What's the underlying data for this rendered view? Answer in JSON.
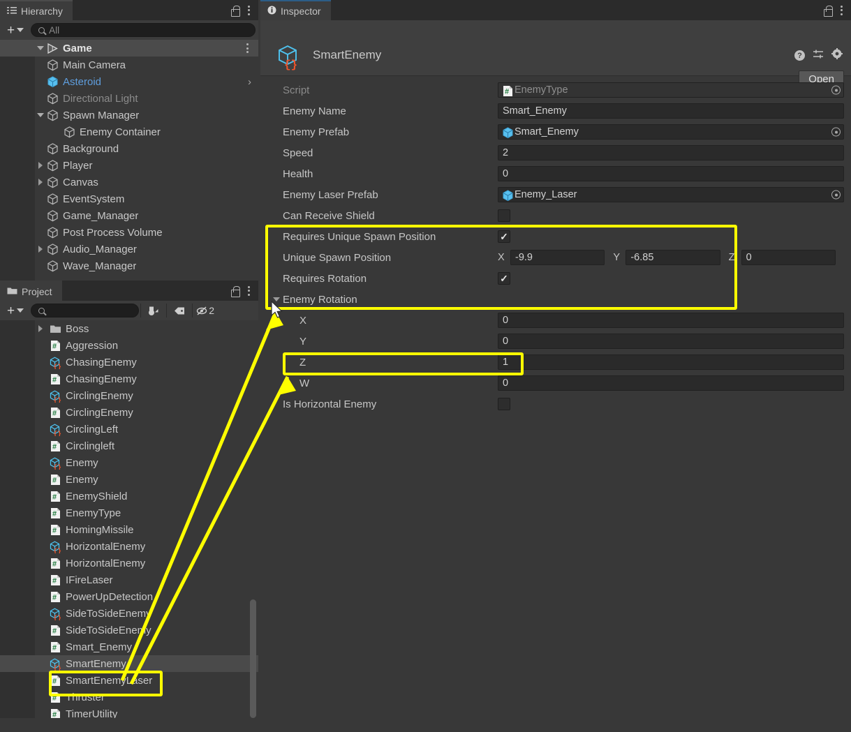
{
  "hierarchy_panel": {
    "tab_label": "Hierarchy",
    "tab_icon": "hierarchy-icon",
    "lock_icon": "lock-icon",
    "menu_icon": "kebab-menu-icon",
    "add_button_label": "+",
    "search_placeholder": "All",
    "search_value": "",
    "scene_name": "Game",
    "items": [
      {
        "label": "Main Camera",
        "icon": "gameobject-cube-icon",
        "indent": 2,
        "twisty": "none",
        "state": "normal"
      },
      {
        "label": "Asteroid",
        "icon": "prefab-cube-icon",
        "indent": 2,
        "twisty": "none",
        "state": "prefab-link",
        "chevron": true
      },
      {
        "label": "Directional Light",
        "icon": "gameobject-cube-icon",
        "indent": 2,
        "twisty": "none",
        "state": "disabled"
      },
      {
        "label": "Spawn Manager",
        "icon": "gameobject-cube-icon",
        "indent": 2,
        "twisty": "expanded",
        "state": "normal"
      },
      {
        "label": "Enemy Container",
        "icon": "gameobject-cube-icon",
        "indent": 3,
        "twisty": "none",
        "state": "normal"
      },
      {
        "label": "Background",
        "icon": "gameobject-cube-icon",
        "indent": 2,
        "twisty": "none",
        "state": "normal"
      },
      {
        "label": "Player",
        "icon": "gameobject-cube-icon",
        "indent": 2,
        "twisty": "collapsed",
        "state": "normal"
      },
      {
        "label": "Canvas",
        "icon": "gameobject-cube-icon",
        "indent": 2,
        "twisty": "collapsed",
        "state": "normal"
      },
      {
        "label": "EventSystem",
        "icon": "gameobject-cube-icon",
        "indent": 2,
        "twisty": "none",
        "state": "normal"
      },
      {
        "label": "Game_Manager",
        "icon": "gameobject-cube-icon",
        "indent": 2,
        "twisty": "none",
        "state": "normal"
      },
      {
        "label": "Post Process Volume",
        "icon": "gameobject-cube-icon",
        "indent": 2,
        "twisty": "none",
        "state": "normal"
      },
      {
        "label": "Audio_Manager",
        "icon": "gameobject-cube-icon",
        "indent": 2,
        "twisty": "collapsed",
        "state": "normal"
      },
      {
        "label": "Wave_Manager",
        "icon": "gameobject-cube-icon",
        "indent": 2,
        "twisty": "none",
        "state": "normal"
      }
    ]
  },
  "project_panel": {
    "tab_label": "Project",
    "tab_icon": "folder-icon",
    "lock_icon": "lock-icon",
    "menu_icon": "kebab-menu-icon",
    "add_button_label": "+",
    "search_placeholder": "",
    "search_value": "",
    "filter_buttons": [
      {
        "name": "type-filter-icon",
        "label": ""
      },
      {
        "name": "label-filter-icon",
        "label": ""
      },
      {
        "name": "hidden-packages-filter-icon",
        "label": "2"
      }
    ],
    "items": [
      {
        "label": "Boss",
        "icon": "folder-icon",
        "twisty": "collapsed",
        "selected": false
      },
      {
        "label": "Aggression",
        "icon": "cs-script-icon",
        "twisty": "none",
        "selected": false
      },
      {
        "label": "ChasingEnemy",
        "icon": "scriptable-object-icon",
        "twisty": "none",
        "selected": false
      },
      {
        "label": "ChasingEnemy",
        "icon": "cs-script-icon",
        "twisty": "none",
        "selected": false
      },
      {
        "label": "CirclingEnemy",
        "icon": "scriptable-object-icon",
        "twisty": "none",
        "selected": false
      },
      {
        "label": "CirclingEnemy",
        "icon": "cs-script-icon",
        "twisty": "none",
        "selected": false
      },
      {
        "label": "CirclingLeft",
        "icon": "scriptable-object-icon",
        "twisty": "none",
        "selected": false
      },
      {
        "label": "Circlingleft",
        "icon": "cs-script-icon",
        "twisty": "none",
        "selected": false
      },
      {
        "label": "Enemy",
        "icon": "scriptable-object-icon",
        "twisty": "none",
        "selected": false
      },
      {
        "label": "Enemy",
        "icon": "cs-script-icon",
        "twisty": "none",
        "selected": false
      },
      {
        "label": "EnemyShield",
        "icon": "cs-script-icon",
        "twisty": "none",
        "selected": false
      },
      {
        "label": "EnemyType",
        "icon": "cs-script-icon",
        "twisty": "none",
        "selected": false
      },
      {
        "label": "HomingMissile",
        "icon": "cs-script-icon",
        "twisty": "none",
        "selected": false
      },
      {
        "label": "HorizontalEnemy",
        "icon": "scriptable-object-icon",
        "twisty": "none",
        "selected": false
      },
      {
        "label": "HorizontalEnemy",
        "icon": "cs-script-icon",
        "twisty": "none",
        "selected": false
      },
      {
        "label": "IFireLaser",
        "icon": "cs-script-icon",
        "twisty": "none",
        "selected": false
      },
      {
        "label": "PowerUpDetection",
        "icon": "cs-script-icon",
        "twisty": "none",
        "selected": false
      },
      {
        "label": "SideToSideEnemy",
        "icon": "scriptable-object-icon",
        "twisty": "none",
        "selected": false
      },
      {
        "label": "SideToSideEnemy",
        "icon": "cs-script-icon",
        "twisty": "none",
        "selected": false
      },
      {
        "label": "Smart_Enemy",
        "icon": "cs-script-icon",
        "twisty": "none",
        "selected": false
      },
      {
        "label": "SmartEnemy",
        "icon": "scriptable-object-icon",
        "twisty": "none",
        "selected": true
      },
      {
        "label": "SmartEnemyLaser",
        "icon": "cs-script-icon",
        "twisty": "none",
        "selected": false
      },
      {
        "label": "Thruster",
        "icon": "cs-script-icon",
        "twisty": "none",
        "selected": false
      },
      {
        "label": "TimerUtility",
        "icon": "cs-script-icon",
        "twisty": "none",
        "selected": false
      }
    ]
  },
  "inspector": {
    "tab_label": "Inspector",
    "tab_icon": "info-icon",
    "lock_icon": "lock-icon",
    "menu_icon": "kebab-menu-icon",
    "object_name": "SmartEnemy",
    "object_icon": "scriptable-object-icon",
    "help_icon": "help-icon",
    "preset_icon": "preset-icon",
    "settings_icon": "gear-icon",
    "open_button_label": "Open",
    "properties": [
      {
        "label": "Script",
        "type": "object",
        "value": "EnemyType",
        "value_icon": "cs-script-icon",
        "readonly": true
      },
      {
        "label": "Enemy Name",
        "type": "text",
        "value": "Smart_Enemy"
      },
      {
        "label": "Enemy Prefab",
        "type": "object",
        "value": "Smart_Enemy",
        "value_icon": "prefab-cube-icon"
      },
      {
        "label": "Speed",
        "type": "number",
        "value": "2"
      },
      {
        "label": "Health",
        "type": "number",
        "value": "0"
      },
      {
        "label": "Enemy Laser Prefab",
        "type": "object",
        "value": "Enemy_Laser",
        "value_icon": "prefab-cube-icon"
      },
      {
        "label": "Can Receive Shield",
        "type": "bool",
        "checked": false
      },
      {
        "label": "Requires Unique Spawn Position",
        "type": "bool",
        "checked": true
      },
      {
        "label": "Unique Spawn Position",
        "type": "vector3",
        "x_label": "X",
        "x": "-9.9",
        "y_label": "Y",
        "y": "-6.85",
        "z_label": "Z",
        "z": "0"
      },
      {
        "label": "Requires Rotation",
        "type": "bool",
        "checked": true
      },
      {
        "label": "Enemy Rotation",
        "type": "foldout",
        "expanded": true
      },
      {
        "label": "X",
        "type": "number",
        "value": "0",
        "sub": true
      },
      {
        "label": "Y",
        "type": "number",
        "value": "0",
        "sub": true
      },
      {
        "label": "Z",
        "type": "number",
        "value": "1",
        "sub": true
      },
      {
        "label": "W",
        "type": "number",
        "value": "0",
        "sub": true
      },
      {
        "label": "Is Horizontal Enemy",
        "type": "bool",
        "checked": false
      }
    ]
  },
  "annotations": {
    "highlight_color": "#ffff00",
    "boxes": [
      {
        "name": "spawn-rotation-settings-highlight"
      },
      {
        "name": "rotation-z-field-highlight"
      },
      {
        "name": "smartenemy-asset-highlight"
      }
    ],
    "arrows": [
      {
        "name": "arrow-to-enemy-rotation-foldout"
      },
      {
        "name": "arrow-to-rotation-z-field"
      }
    ]
  }
}
